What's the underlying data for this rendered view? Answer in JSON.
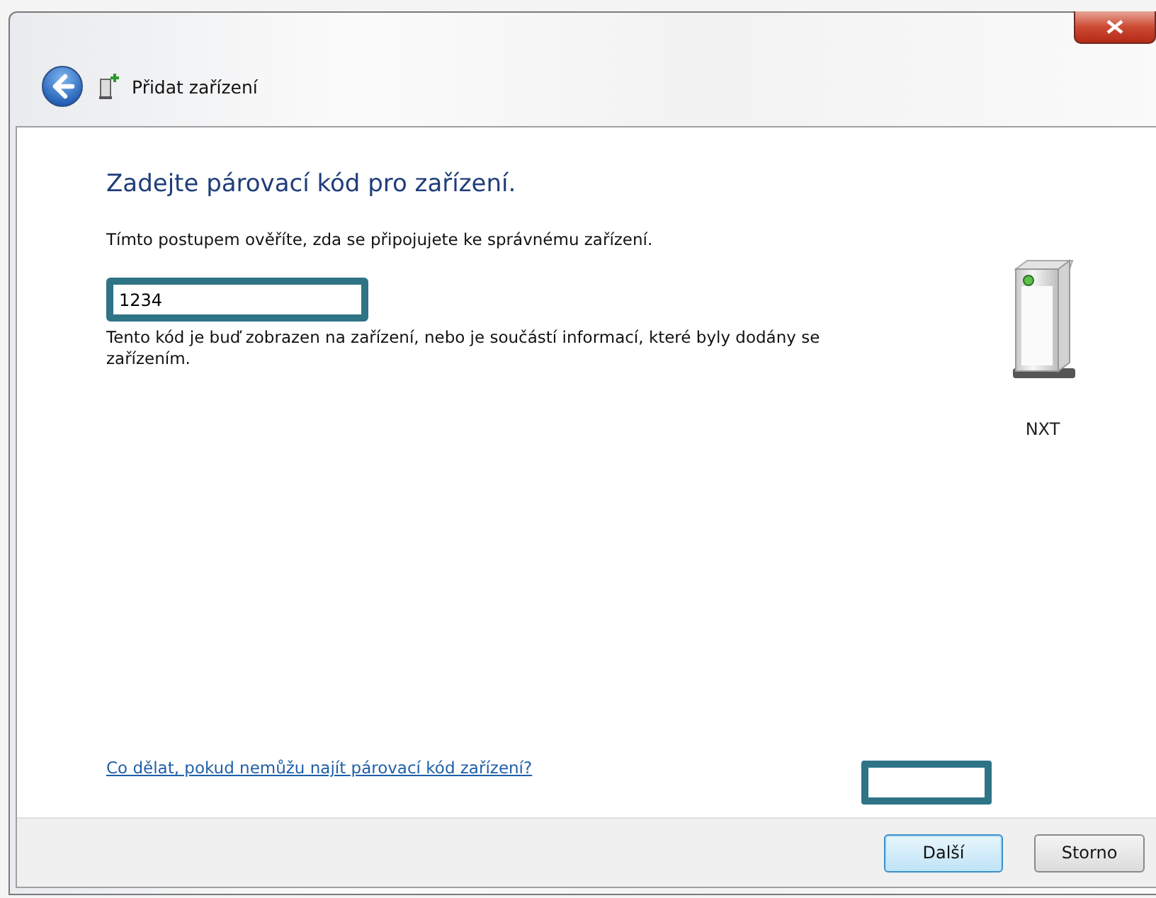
{
  "window": {
    "title": "Přidat zařízení"
  },
  "heading": "Zadejte párovací kód pro zařízení.",
  "instruction": "Tímto postupem ověříte, zda se připojujete ke správnému zařízení.",
  "code_field": {
    "value": "1234"
  },
  "help_text": "Tento kód je buď zobrazen na zařízení, nebo je součástí informací, které byly dodány se zařízením.",
  "device": {
    "name": "NXT"
  },
  "link": "Co dělat, pokud nemůžu najít párovací kód zařízení?",
  "buttons": [
    {
      "label": "Další",
      "focused": true
    },
    {
      "label": "Storno",
      "focused": false
    }
  ]
}
